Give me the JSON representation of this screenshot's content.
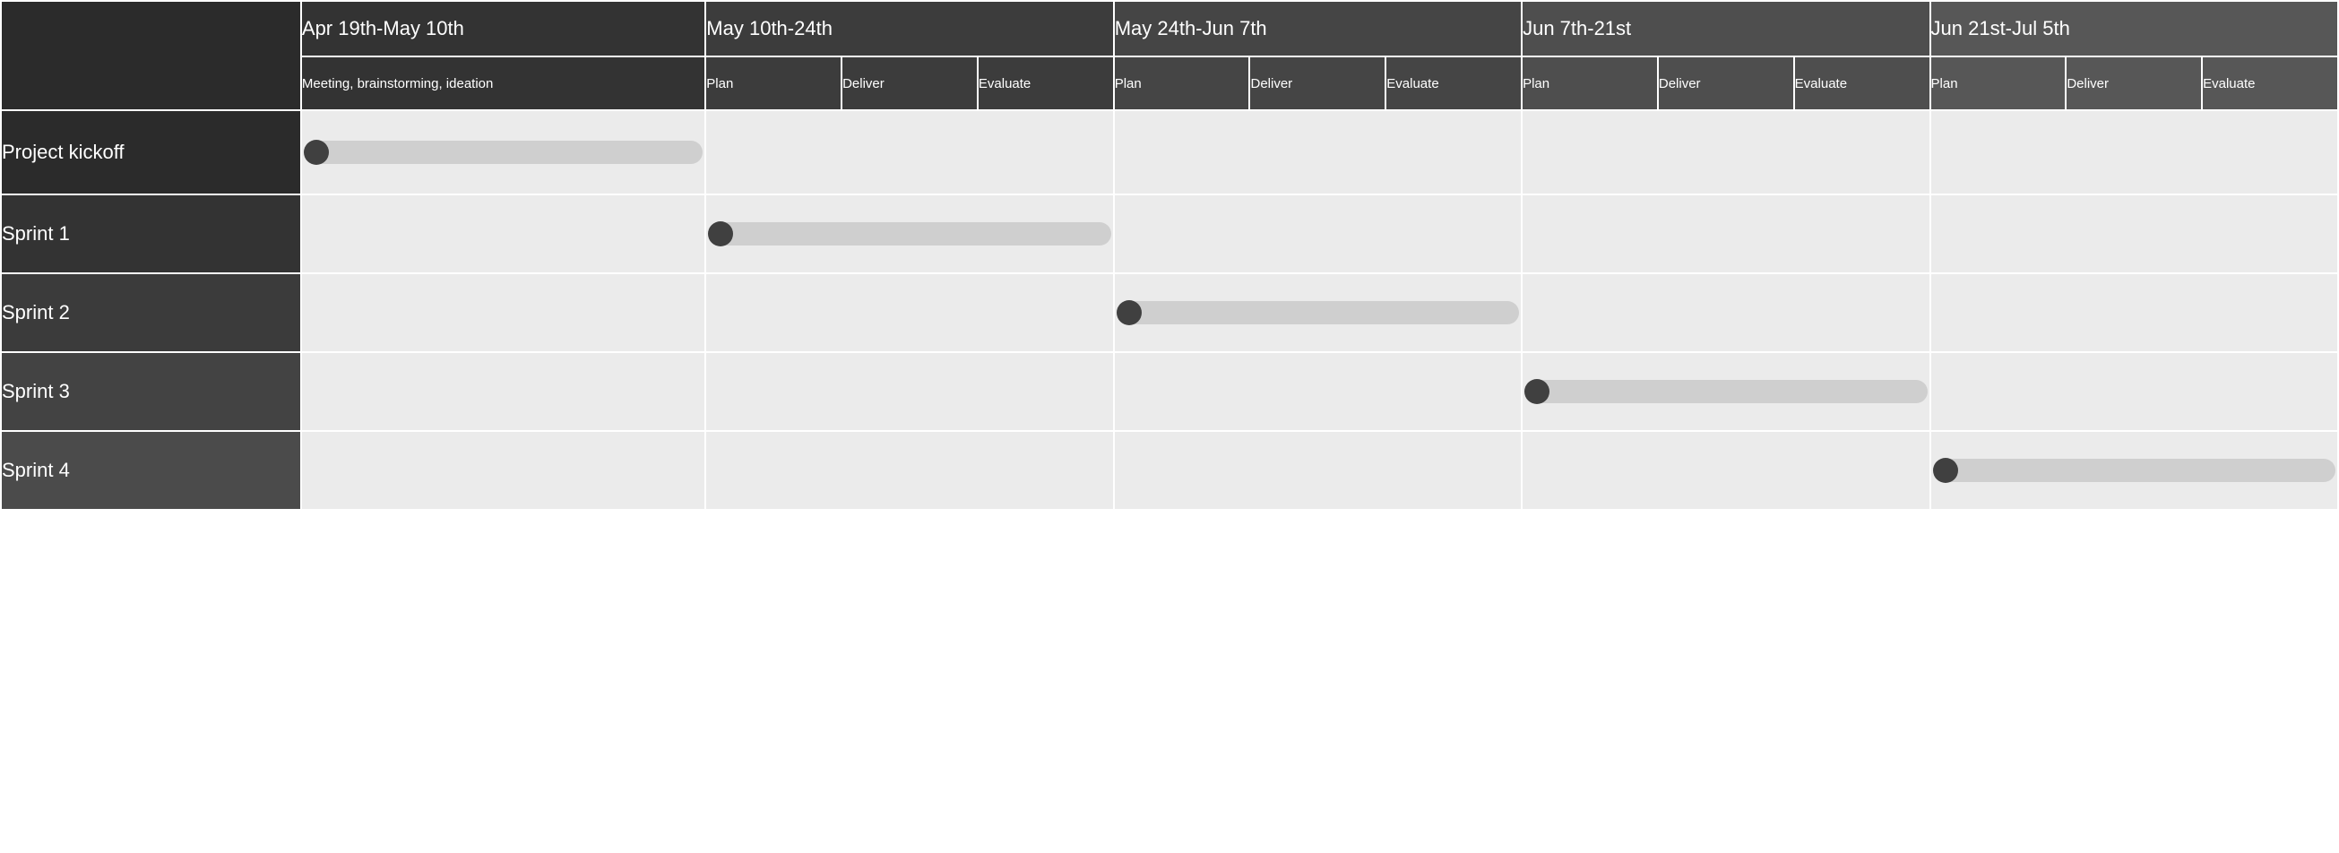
{
  "periods": [
    {
      "label": "Apr 19th-May 10th",
      "subs": [
        "Meeting, brainstorming, ideation"
      ]
    },
    {
      "label": "May 10th-24th",
      "subs": [
        "Plan",
        "Deliver",
        "Evaluate"
      ]
    },
    {
      "label": "May 24th-Jun 7th",
      "subs": [
        "Plan",
        "Deliver",
        "Evaluate"
      ]
    },
    {
      "label": "Jun 7th-21st",
      "subs": [
        "Plan",
        "Deliver",
        "Evaluate"
      ]
    },
    {
      "label": "Jun 21st-Jul 5th",
      "subs": [
        "Plan",
        "Deliver",
        "Evaluate"
      ]
    }
  ],
  "rows": [
    {
      "label": "Project kickoff",
      "bar_period": 0
    },
    {
      "label": "Sprint 1",
      "bar_period": 1
    },
    {
      "label": "Sprint 2",
      "bar_period": 2
    },
    {
      "label": "Sprint 3",
      "bar_period": 3
    },
    {
      "label": "Sprint 4",
      "bar_period": 4
    }
  ],
  "colors": {
    "bar_track": "#cfcfcf",
    "bar_dot": "#404040",
    "body_cell": "#ebebeb"
  }
}
